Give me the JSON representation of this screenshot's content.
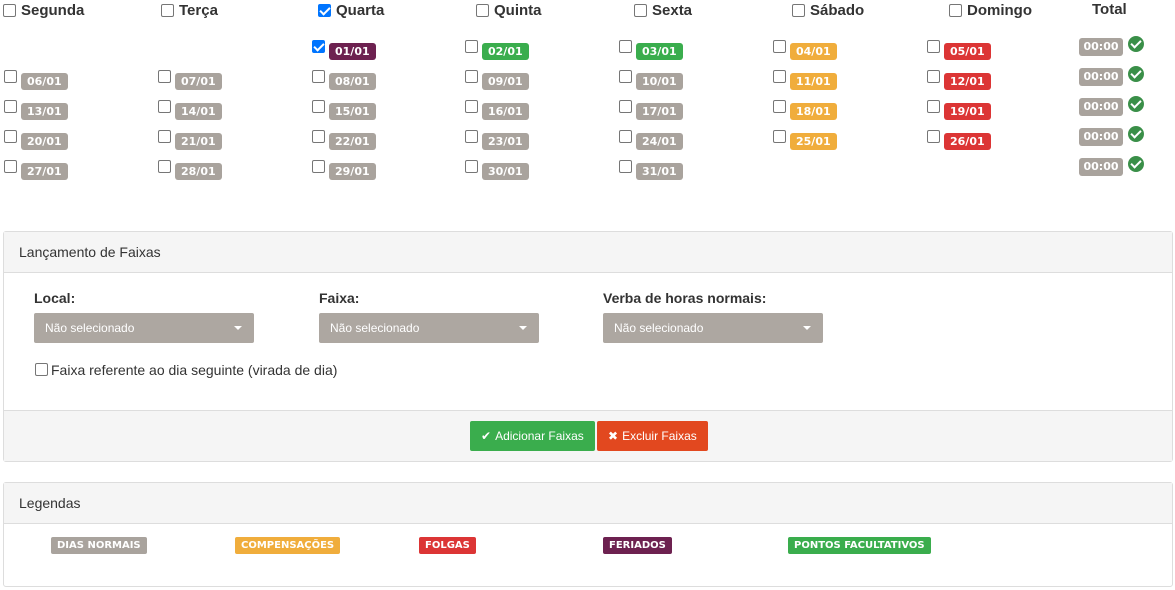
{
  "weekdays": {
    "seg": {
      "label": "Segunda",
      "checked": false
    },
    "ter": {
      "label": "Terça",
      "checked": false
    },
    "qua": {
      "label": "Quarta",
      "checked": true
    },
    "qui": {
      "label": "Quinta",
      "checked": false
    },
    "sex": {
      "label": "Sexta",
      "checked": false
    },
    "sab": {
      "label": "Sábado",
      "checked": false
    },
    "dom": {
      "label": "Domingo",
      "checked": false
    }
  },
  "total_label": "Total",
  "calendar": {
    "week1": {
      "qua": {
        "date": "01/01",
        "type": "feriado",
        "checked": true
      },
      "qui": {
        "date": "02/01",
        "type": "ponto"
      },
      "sex": {
        "date": "03/01",
        "type": "ponto"
      },
      "sab": {
        "date": "04/01",
        "type": "comp"
      },
      "dom": {
        "date": "05/01",
        "type": "folga"
      },
      "total": "00:00"
    },
    "week2": {
      "seg": {
        "date": "06/01"
      },
      "ter": {
        "date": "07/01"
      },
      "qua": {
        "date": "08/01"
      },
      "qui": {
        "date": "09/01"
      },
      "sex": {
        "date": "10/01"
      },
      "sab": {
        "date": "11/01",
        "type": "comp"
      },
      "dom": {
        "date": "12/01",
        "type": "folga"
      },
      "total": "00:00"
    },
    "week3": {
      "seg": {
        "date": "13/01"
      },
      "ter": {
        "date": "14/01"
      },
      "qua": {
        "date": "15/01"
      },
      "qui": {
        "date": "16/01"
      },
      "sex": {
        "date": "17/01"
      },
      "sab": {
        "date": "18/01",
        "type": "comp"
      },
      "dom": {
        "date": "19/01",
        "type": "folga"
      },
      "total": "00:00"
    },
    "week4": {
      "seg": {
        "date": "20/01"
      },
      "ter": {
        "date": "21/01"
      },
      "qua": {
        "date": "22/01"
      },
      "qui": {
        "date": "23/01"
      },
      "sex": {
        "date": "24/01"
      },
      "sab": {
        "date": "25/01",
        "type": "comp"
      },
      "dom": {
        "date": "26/01",
        "type": "folga"
      },
      "total": "00:00"
    },
    "week5": {
      "seg": {
        "date": "27/01"
      },
      "ter": {
        "date": "28/01"
      },
      "qua": {
        "date": "29/01"
      },
      "qui": {
        "date": "30/01"
      },
      "sex": {
        "date": "31/01"
      },
      "total": "00:00"
    }
  },
  "colors": {
    "normal": "#a9a39d",
    "comp": "#f0ad3c",
    "folga": "#dc3535",
    "feriado": "#6d2150",
    "ponto": "#3aad4d",
    "success": "#3aad4d",
    "danger": "#e2481f"
  },
  "faixas_panel": {
    "title": "Lançamento de Faixas",
    "local_label": "Local:",
    "local_value": "Não selecionado",
    "faixa_label": "Faixa:",
    "faixa_value": "Não selecionado",
    "verba_label": "Verba de horas normais:",
    "verba_value": "Não selecionado",
    "virada_label": "Faixa referente ao dia seguinte (virada de dia)",
    "add_button": "Adicionar Faixas",
    "delete_button": "Excluir Faixas",
    "add_icon": "check-icon",
    "delete_icon": "times-icon"
  },
  "legend_panel": {
    "title": "Legendas",
    "normal": "DIAS NORMAIS",
    "comp": "COMPENSAÇÕES",
    "folga": "FOLGAS",
    "feriado": "FERIADOS",
    "ponto": "PONTOS FACULTATIVOS"
  }
}
